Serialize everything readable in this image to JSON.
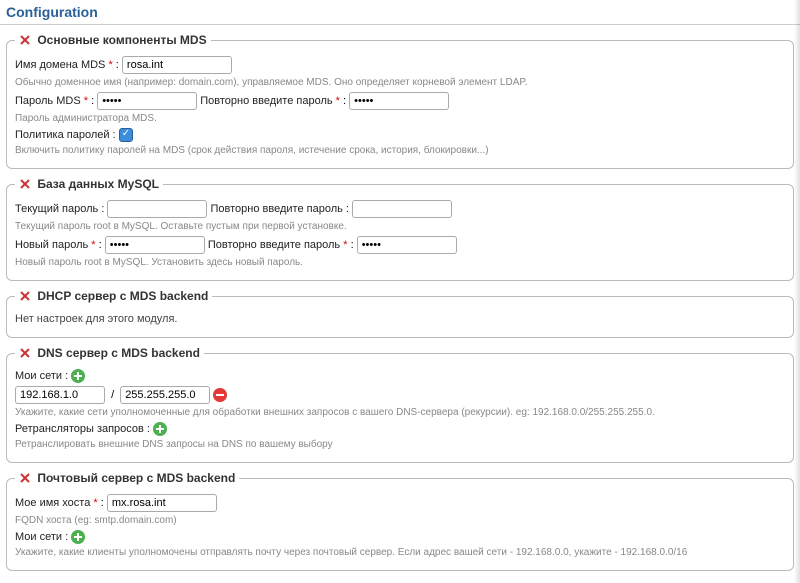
{
  "page": {
    "title": "Configuration"
  },
  "mds_core": {
    "legend": "Основные компоненты MDS",
    "domain_label": "Имя домена MDS",
    "colon": " :",
    "domain_value": "rosa.int",
    "domain_hint": "Обычно доменное имя (например: domain.com), управляемое MDS. Оно определяет корневой элемент LDAP.",
    "password_label": "Пароль MDS",
    "password_value": "•••••",
    "password_repeat_label": "Повторно введите пароль",
    "password_repeat_value": "•••••",
    "admin_hint": "Пароль администратора MDS.",
    "policy_label": "Политика паролей :",
    "policy_hint": "Включить политику паролей на MDS (срок действия пароля, истечение срока, история, блокировки...)"
  },
  "mysql": {
    "legend": "База данных MySQL",
    "cur_label": "Текущий пароль :",
    "cur_repeat_label": "Повторно введите пароль :",
    "cur_hint": "Текущий пароль root в MySQL. Оставьте пустым при первой установке.",
    "new_label": "Новый пароль",
    "new_value": "•••••",
    "new_repeat_label": "Повторно введите пароль",
    "new_repeat_value": "•••••",
    "new_hint": "Новый пароль root в MySQL. Установить здесь новый пароль."
  },
  "dhcp": {
    "legend": "DHCP сервер с MDS backend",
    "none": "Нет настроек для этого модуля."
  },
  "dns": {
    "legend": "DNS сервер с MDS backend",
    "nets_label": "Мои сети :",
    "net_ip": "192.168.1.0",
    "net_mask": "255.255.255.0",
    "slash": "/",
    "nets_hint": "Укажите, какие сети уполномоченные для обработки внешних запросов с вашего DNS-сервера (рекурсии). eg: 192.168.0.0/255.255.255.0.",
    "fwd_label": "Ретрансляторы запросов :",
    "fwd_hint": "Ретранслировать внешние DNS запросы на DNS по вашему выбору"
  },
  "mail": {
    "legend": "Почтовый сервер с MDS backend",
    "host_label": "Мое имя хоста",
    "host_value": "mx.rosa.int",
    "host_hint": "FQDN хоста (eg: smtp.domain.com)",
    "nets_label": "Мои сети :",
    "nets_hint": "Укажите, какие клиенты уполномочены отправлять почту через почтовый сервер. Если адрес вашей сети - 192.168.0.0, укажите - 192.168.0.0/16"
  },
  "common": {
    "req": "*"
  }
}
